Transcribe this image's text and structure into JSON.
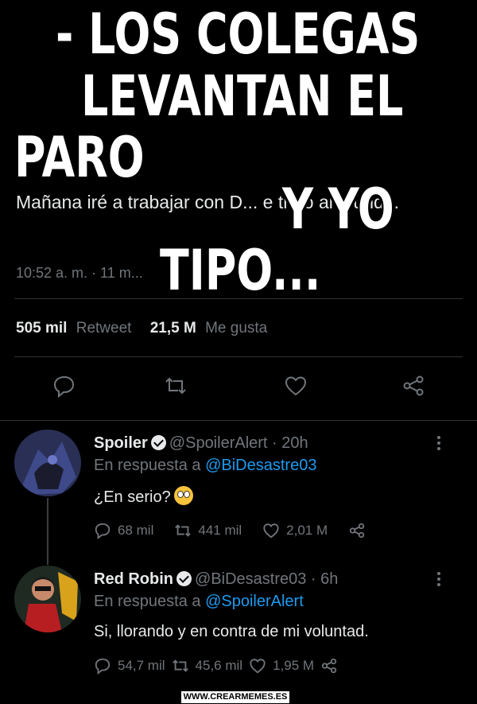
{
  "meme": {
    "line1": "- LOS COLEGAS",
    "line2": "LEVANTAN EL",
    "line3": "PARO",
    "line4": "Y YO",
    "line5": "TIPO..."
  },
  "tweet": {
    "text": "Mañana iré a trabajar con D... e trajo al mundo.",
    "time": "10:52 a. m. · 11 m...",
    "retweets_count": "505 mil",
    "retweets_label": "Retweet",
    "likes_count": "21,5 M",
    "likes_label": "Me gusta"
  },
  "replies": [
    {
      "name": "Spoiler",
      "handle": "@SpoilerAlert · 20h",
      "in_reply_prefix": "En respuesta a",
      "in_reply_to": "@BiDesastre03",
      "text": "¿En serio?",
      "comments": "68 mil",
      "retweets": "441 mil",
      "likes": "2,01 M"
    },
    {
      "name": "Red Robin",
      "handle": "@BiDesastre03 · 6h",
      "in_reply_prefix": "En respuesta a",
      "in_reply_to": "@SpoilerAlert",
      "text": "Si, llorando y en contra de mi voluntad.",
      "comments": "54,7 mil",
      "retweets": "45,6 mil",
      "likes": "1,95 M"
    }
  ],
  "icons": [
    "comment-icon",
    "retweet-icon",
    "heart-icon",
    "share-icon",
    "verified-icon",
    "more-icon",
    "flushed-emoji-icon"
  ],
  "colors": {
    "background": "#000000",
    "text": "#e7e9ea",
    "muted": "#71767b",
    "link": "#1d9bf0"
  },
  "watermark": "WWW.CREARMEMES.ES"
}
